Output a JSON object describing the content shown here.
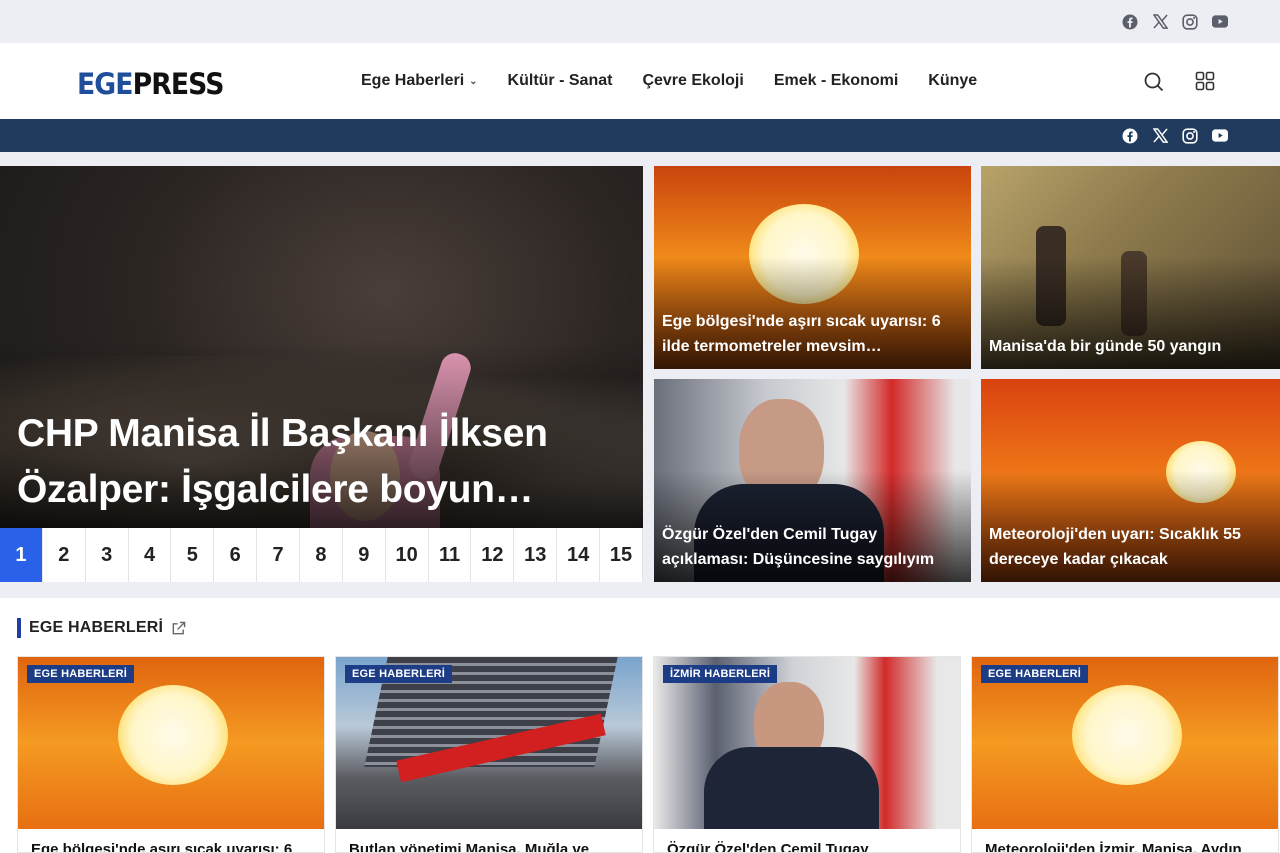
{
  "brand": {
    "logo_part1": "EGE",
    "logo_part2": "PRESS"
  },
  "social": [
    "facebook-icon",
    "x-icon",
    "instagram-icon",
    "youtube-icon"
  ],
  "nav": [
    {
      "label": "Ege Haberleri",
      "has_dropdown": true
    },
    {
      "label": "Kültür - Sanat"
    },
    {
      "label": "Çevre Ekoloji"
    },
    {
      "label": "Emek - Ekonomi"
    },
    {
      "label": "Künye"
    }
  ],
  "slider": {
    "main_title": "CHP Manisa İl Başkanı İlksen Özalper: İşgalcilere boyun…",
    "pages": [
      "1",
      "2",
      "3",
      "4",
      "5",
      "6",
      "7",
      "8",
      "9",
      "10",
      "11",
      "12",
      "13",
      "14",
      "15"
    ],
    "active_page": "1"
  },
  "featured": [
    {
      "title": "Ege bölgesi'nde aşırı sıcak uyarısı: 6 ilde termometreler mevsim…"
    },
    {
      "title": "Manisa'da bir günde 50 yangın"
    },
    {
      "title": "Özgür Özel'den Cemil Tugay açıklaması: Düşüncesine saygılıyım"
    },
    {
      "title": "Meteoroloji'den uyarı: Sıcaklık 55 dereceye kadar çıkacak"
    }
  ],
  "section": {
    "title": "EGE HABERLERİ",
    "items": [
      {
        "badge": "EGE HABERLERİ",
        "title": "Ege bölgesi'nde aşırı sıcak uyarısı: 6"
      },
      {
        "badge": "EGE HABERLERİ",
        "title": "Butlan yönetimi Manisa, Muğla ve"
      },
      {
        "badge": "İZMİR HABERLERİ",
        "title": "Özgür Özel'den Cemil Tugay"
      },
      {
        "badge": "EGE HABERLERİ",
        "title": "Meteoroloji'den İzmir, Manisa, Aydın"
      }
    ]
  },
  "colors": {
    "accent": "#2962e8",
    "navy": "#203b5d",
    "badge": "#1d3c86",
    "logo_blue": "#1f4f9a"
  }
}
